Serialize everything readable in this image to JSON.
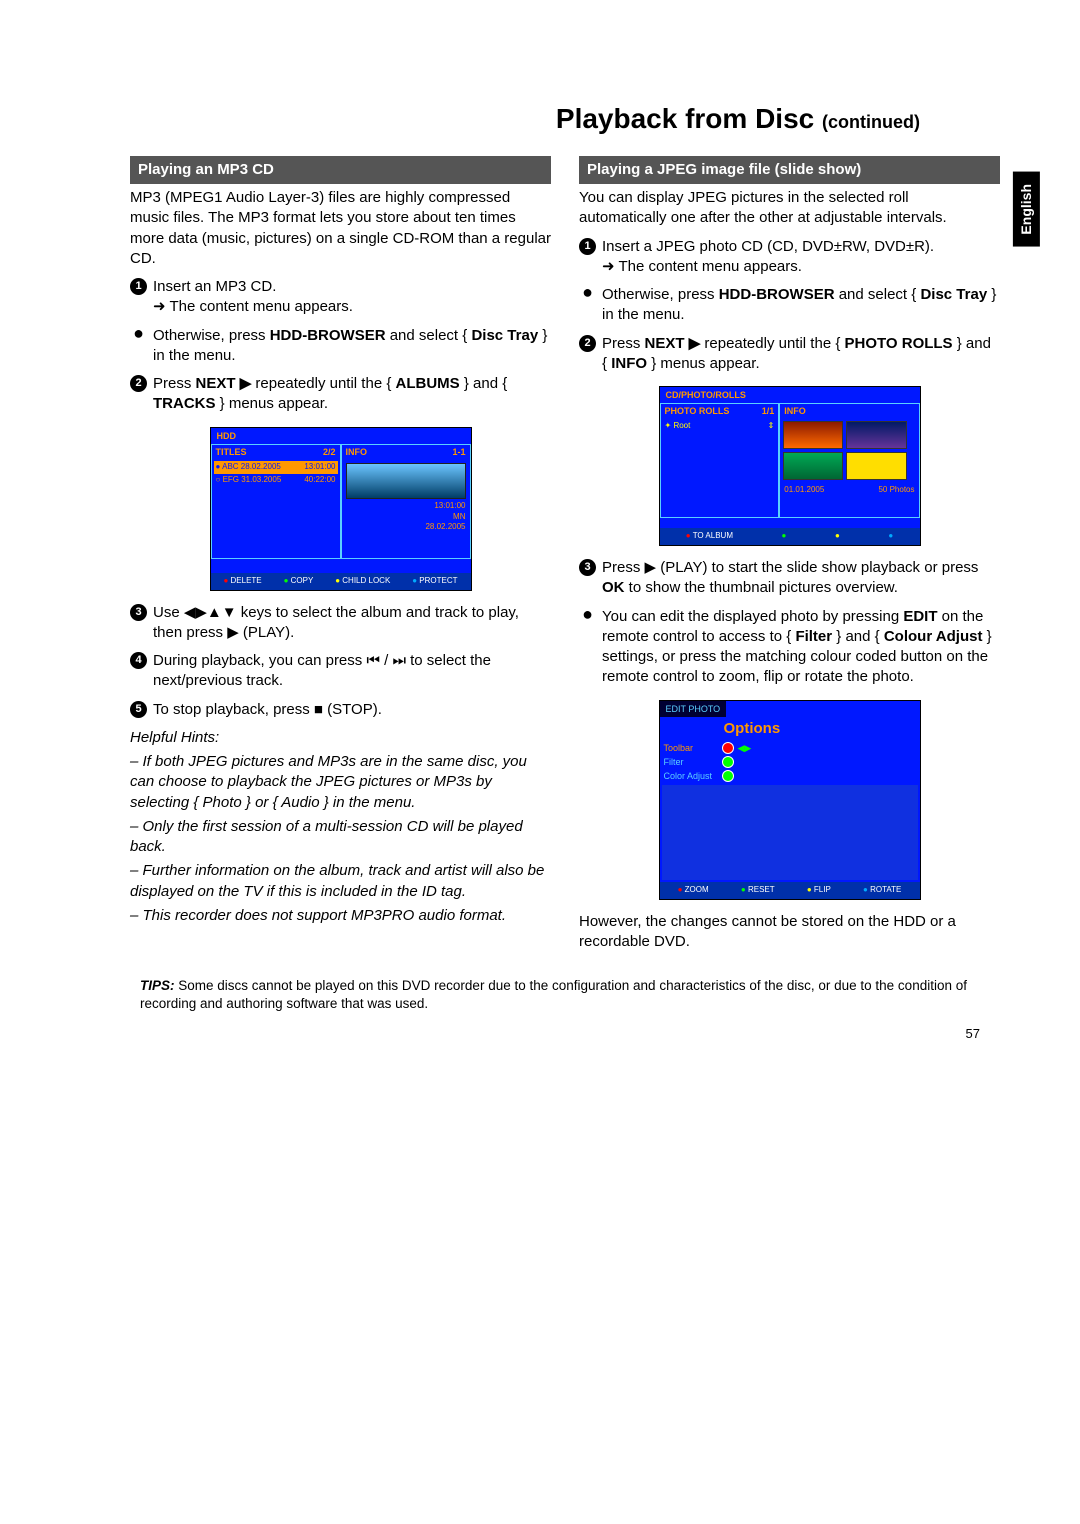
{
  "sideTab": "English",
  "pageTitle": "Playback from Disc",
  "pageTitleCont": "(continued)",
  "pageNum": "57",
  "left": {
    "heading": "Playing an MP3 CD",
    "intro": "MP3 (MPEG1 Audio Layer-3) files are highly compressed music files. The MP3 format lets you store about ten times more data (music, pictures) on a single CD-ROM than a regular CD.",
    "s1a": "Insert an MP3 CD.",
    "s1b": "➜ The content menu appears.",
    "b1a": "Otherwise, press ",
    "b1bold1": "HDD-BROWSER",
    "b1b": " and select { ",
    "b1bold2": "Disc Tray",
    "b1c": " } in the menu.",
    "s2a": "Press ",
    "s2bold": "NEXT ▶",
    "s2b": " repeatedly until the { ",
    "s2bold2": "ALBUMS",
    "s2c": " } and { ",
    "s2bold3": "TRACKS",
    "s2d": " } menus appear.",
    "s3": "Use ◀▶▲▼ keys to select the album and track to play, then press ▶ (PLAY).",
    "s4": "During playback, you can press ⏮ / ⏭ to select the next/previous track.",
    "s5": "To stop playback, press ■ (STOP).",
    "hintsLabel": "Helpful Hints:",
    "h1": "– If both JPEG pictures and MP3s are in the same disc, you can choose to playback the JPEG pictures or MP3s by selecting { Photo } or { Audio } in the menu.",
    "h2": "– Only the first session of a multi-session CD will be played back.",
    "h3": "– Further information on the album, track and artist will also be displayed on the TV if this is included in the ID tag.",
    "h4": "– This recorder does not support MP3PRO audio format.",
    "fig": {
      "tab": "HDD",
      "titles": "TITLES",
      "tcount": "2/2",
      "info": "INFO",
      "icount": "1-1",
      "r1a": "ABC 28.02.2005",
      "r1b": "13:01:00",
      "r2a": "EFG 31.03.2005",
      "r2b": "40:22:00",
      "i1": "13:01:00",
      "i2": "MN",
      "i3": "28.02.2005",
      "btn1": "DELETE",
      "btn2": "COPY",
      "btn3": "CHILD LOCK",
      "btn4": "PROTECT"
    }
  },
  "right": {
    "heading": "Playing a JPEG image file (slide show)",
    "intro": "You can display JPEG pictures in the selected roll automatically one after the other at adjustable intervals.",
    "s1a": "Insert a JPEG photo CD (CD, DVD±RW, DVD±R).",
    "s1b": "➜ The content menu appears.",
    "b1a": "Otherwise, press ",
    "b1bold1": "HDD-BROWSER",
    "b1b": " and select { ",
    "b1bold2": "Disc Tray",
    "b1c": " } in the menu.",
    "s2a": "Press ",
    "s2bold": "NEXT ▶",
    "s2b": " repeatedly until the { ",
    "s2bold2": "PHOTO ROLLS",
    "s2c": " } and { ",
    "s2bold3": "INFO",
    "s2d": " } menus appear.",
    "s3a": "Press ▶ (PLAY) to start the slide show playback or press ",
    "s3bold": "OK",
    "s3b": " to show the thumbnail pictures overview.",
    "b2a": "You can edit the displayed photo by pressing ",
    "b2bold1": "EDIT",
    "b2b": " on the remote control to access to { ",
    "b2bold2": "Filter",
    "b2c": " } and { ",
    "b2bold3": "Colour Adjust",
    "b2d": " } settings, or press the matching colour coded button on the remote control to zoom, flip or rotate the photo.",
    "after": "However, the changes cannot be stored on the HDD or a recordable DVD.",
    "fig1": {
      "tab": "CD/PHOTO/ROLLS",
      "ph": "PHOTO ROLLS",
      "phc": "1/1",
      "info": "INFO",
      "root": "Root",
      "d1": "01.01.2005",
      "d2": "50 Photos",
      "btn1": "TO ALBUM"
    },
    "fig2": {
      "tab": "EDIT PHOTO",
      "opt": "Options",
      "r1": "Toolbar",
      "r2": "Filter",
      "r3": "Color Adjust",
      "btn1": "ZOOM",
      "btn2": "RESET",
      "btn3": "FLIP",
      "btn4": "ROTATE"
    }
  },
  "tips": {
    "label": "TIPS:",
    "text": "Some discs cannot be played on this DVD recorder due to the configuration and characteristics of the disc, or due to the condition of recording and authoring software that was used."
  }
}
